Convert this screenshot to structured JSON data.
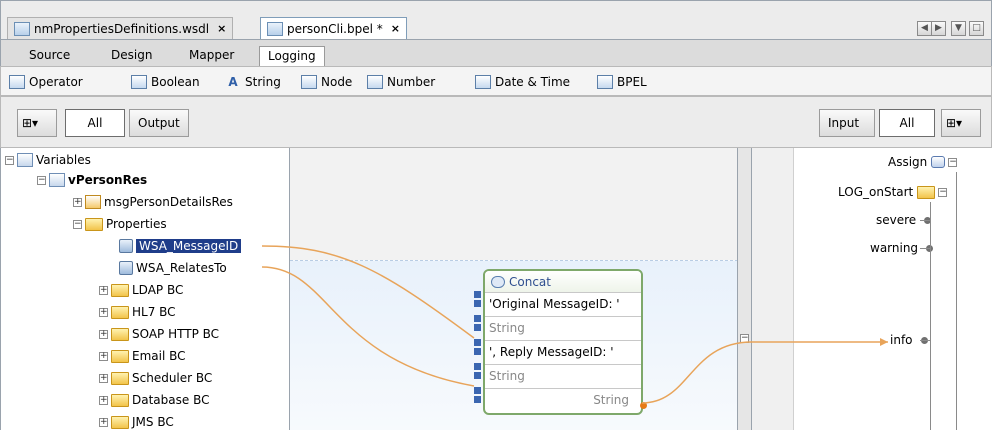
{
  "tabs": [
    {
      "label": "nmPropertiesDefinitions.wsdl",
      "icon": "wsdl-file-icon"
    },
    {
      "label": "personCli.bpel *",
      "icon": "bpel-file-icon"
    }
  ],
  "close_glyph": "×",
  "view_tabs": [
    "Source",
    "Design",
    "Mapper",
    "Logging"
  ],
  "palette": [
    {
      "label": "Operator",
      "icon": "operator-icon"
    },
    {
      "label": "Boolean",
      "icon": "boolean-icon"
    },
    {
      "label": "String",
      "icon": "string-icon"
    },
    {
      "label": "Node",
      "icon": "node-icon"
    },
    {
      "label": "Number",
      "icon": "number-icon"
    },
    {
      "label": "Date & Time",
      "icon": "date-time-icon"
    },
    {
      "label": "BPEL",
      "icon": "bpel-icon"
    }
  ],
  "toolbar": {
    "left_all": "All",
    "left_output": "Output",
    "right_input": "Input",
    "right_all": "All"
  },
  "tree": {
    "variables": "Variables",
    "vPersonRes": "vPersonRes",
    "msgPersonDetailsRes": "msgPersonDetailsRes",
    "properties": "Properties",
    "wsa_message_id": "WSA_MessageID",
    "wsa_relates_to": "WSA_RelatesTo",
    "folders": [
      "LDAP BC",
      "HL7 BC",
      "SOAP HTTP BC",
      "Email BC",
      "Scheduler BC",
      "Database BC",
      "JMS BC"
    ]
  },
  "concat": {
    "title": "Concat",
    "rows": [
      "'Original MessageID: '",
      "String",
      "', Reply MessageID: '",
      "String"
    ],
    "output": "String"
  },
  "right": {
    "assign": "Assign",
    "log_on_start": "LOG_onStart",
    "severe": "severe",
    "warning": "warning",
    "info": "info"
  },
  "colors": {
    "link": "#e8a45a",
    "selection": "#1f3d8a",
    "concat_border": "#7ea86a"
  }
}
